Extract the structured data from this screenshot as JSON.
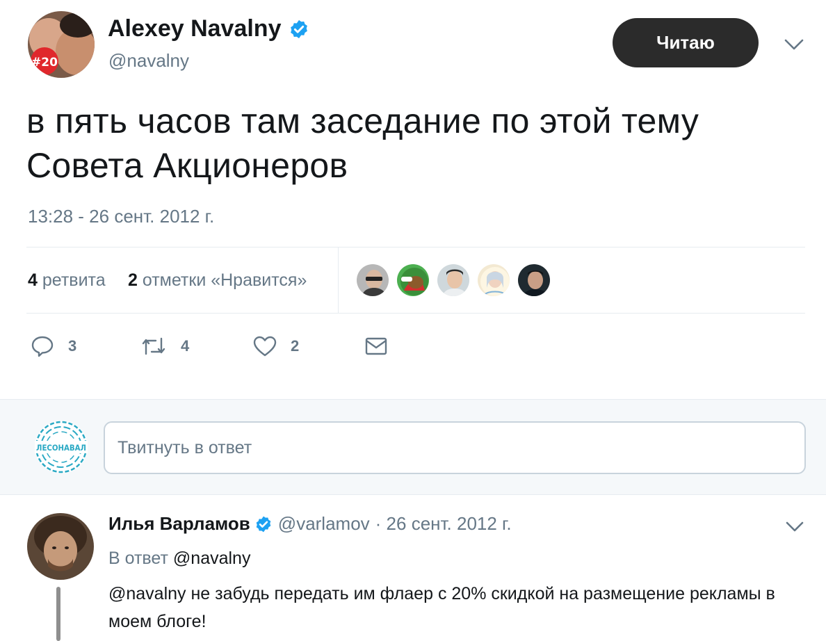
{
  "tweet": {
    "author_name": "Alexey Navalny",
    "author_handle": "@navalny",
    "avatar_badge": "#20",
    "follow_label": "Читаю",
    "text": "в пять часов там заседание по этой тему Совета Акционеров",
    "timestamp": "13:28 - 26 сент. 2012 г.",
    "stats": {
      "retweets_count": "4",
      "retweets_label": "ретвита",
      "likes_count": "2",
      "likes_label": "отметки «Нравится»"
    },
    "actions": {
      "reply_count": "3",
      "retweet_count": "4",
      "like_count": "2"
    }
  },
  "reply_composer": {
    "placeholder": "Твитнуть в ответ",
    "account_logo_text": "ЛЕСОНАВАЛ"
  },
  "reply": {
    "author_name": "Илья Варламов",
    "author_handle": "@varlamov",
    "date": "· 26 сент. 2012 г.",
    "reply_to_prefix": "В ответ",
    "reply_to_handle": "@navalny",
    "text": "@navalny не забудь передать им флаер с 20% скидкой на размещение рекламы в моем блоге!"
  },
  "colors": {
    "verified": "#1da1f2",
    "muted_text": "#657786",
    "follow_button_bg": "#2b2b2b",
    "logo_teal": "#2aa9c4",
    "logo_orange": "#ff6a00"
  },
  "icons": [
    "verified-badge-icon",
    "chevron-down-icon",
    "reply-icon",
    "retweet-icon",
    "heart-icon",
    "envelope-icon"
  ]
}
